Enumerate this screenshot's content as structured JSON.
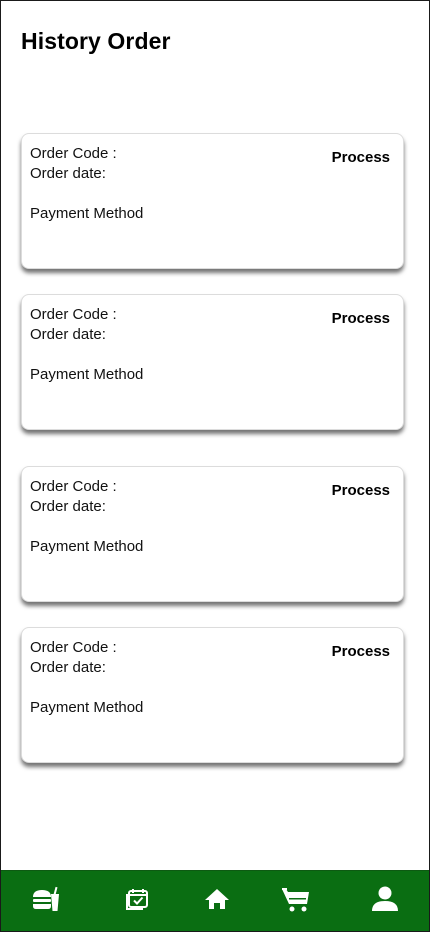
{
  "header": {
    "title": "History Order"
  },
  "orders": [
    {
      "code_label": "Order Code :",
      "date_label": "Order date:",
      "payment_label": "Payment Method",
      "status": "Process"
    },
    {
      "code_label": "Order Code :",
      "date_label": "Order date:",
      "payment_label": "Payment Method",
      "status": "Process"
    },
    {
      "code_label": "Order Code :",
      "date_label": "Order date:",
      "payment_label": "Payment Method",
      "status": "Process"
    },
    {
      "code_label": "Order Code :",
      "date_label": "Order date:",
      "payment_label": "Payment Method",
      "status": "Process"
    }
  ],
  "bottom_nav": {
    "background": "#0a6e12",
    "items": [
      {
        "icon": "food-icon"
      },
      {
        "icon": "calendar-check-icon"
      },
      {
        "icon": "home-icon"
      },
      {
        "icon": "cart-icon"
      },
      {
        "icon": "user-icon"
      }
    ]
  }
}
